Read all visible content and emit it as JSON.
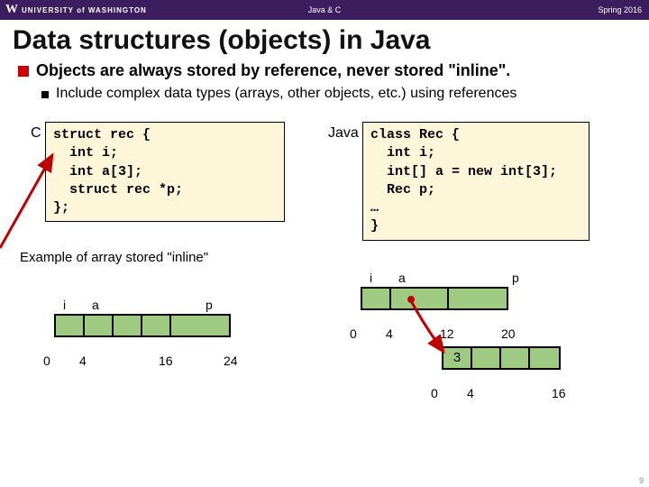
{
  "header": {
    "logo_w": "W",
    "logo_text": "UNIVERSITY of WASHINGTON",
    "center": "Java & C",
    "right": "Spring 2016"
  },
  "title": "Data structures (objects) in Java",
  "bullet1": "Objects are always stored by reference, never stored \"inline\".",
  "bullet2": "Include complex data types (arrays, other objects, etc.) using references",
  "code_c_label": "C",
  "code_c": "struct rec {\n  int i;\n  int a[3];\n  struct rec *p;\n};",
  "code_java_label": "Java",
  "code_java": "class Rec {\n  int i;\n  int[] a = new int[3];\n  Rec p;\n…\n}",
  "example_label": "Example of array stored \"inline\"",
  "diag_left": {
    "top_i": "i",
    "top_a": "a",
    "top_p": "p",
    "b0": "0",
    "b4": "4",
    "b16": "16",
    "b24": "24"
  },
  "diag_right_top": {
    "top_i": "i",
    "top_a": "a",
    "top_p": "p",
    "b0": "0",
    "b4": "4",
    "b12": "12",
    "b20": "20"
  },
  "diag_right_bot": {
    "val3": "3",
    "b0": "0",
    "b4": "4",
    "b16": "16"
  },
  "pagenum": "9"
}
